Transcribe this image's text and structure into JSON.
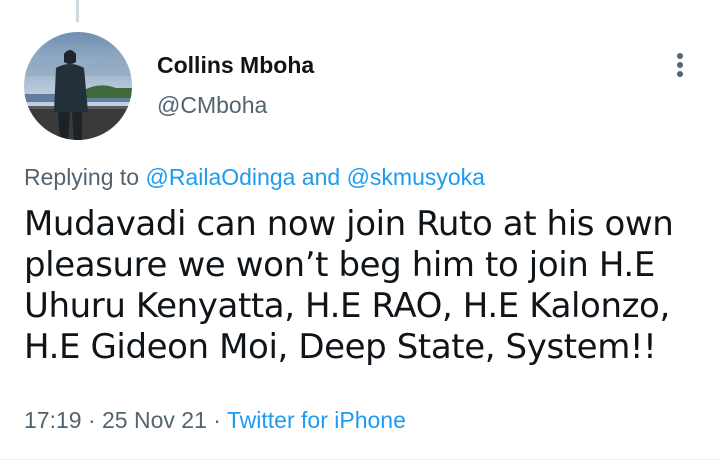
{
  "author": {
    "display_name": "Collins Mboha",
    "handle": "@CMboha"
  },
  "reply": {
    "prefix": "Replying to ",
    "user1": "@RailaOdinga",
    "conjunction": " and ",
    "user2": "@skmusyoka"
  },
  "tweet": {
    "lines": [
      "Mudavadi can now join Ruto at his own",
      "pleasure we won’t beg him to join H.E",
      "Uhuru Kenyatta, H.E RAO, H.E Kalonzo,",
      "H.E Gideon Moi, Deep State, System!!"
    ]
  },
  "meta": {
    "time": "17:19",
    "separator": " · ",
    "date": "25 Nov 21",
    "source": "Twitter for iPhone"
  },
  "icons": {
    "more": "more-vertical-icon"
  },
  "colors": {
    "text": "#0f1419",
    "secondary": "#536471",
    "link": "#1d9bf0"
  }
}
